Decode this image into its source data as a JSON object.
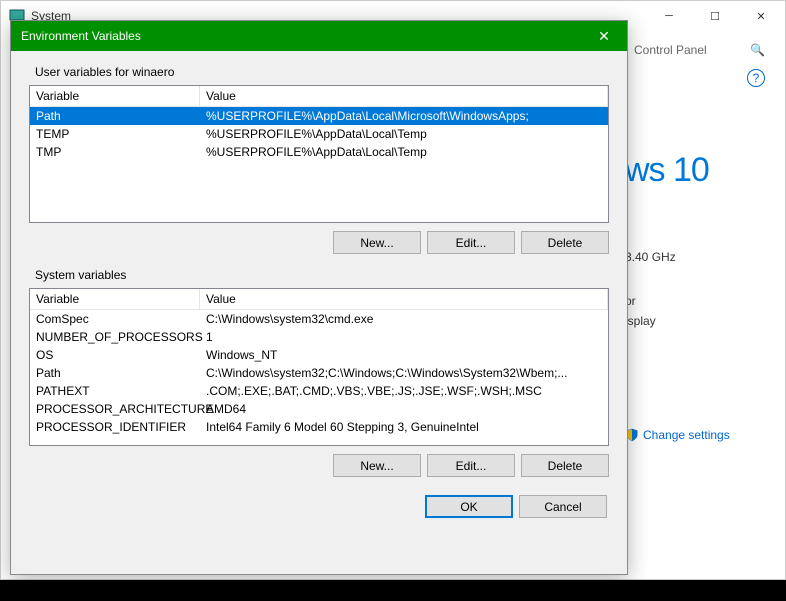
{
  "bg": {
    "title": "System",
    "control_panel": "Control Panel",
    "windows10": "ws 10",
    "ghz": "3.40 GHz",
    "or": "or",
    "isplay": "isplay",
    "change_settings": "Change settings",
    "search_placeholder": ""
  },
  "dialog": {
    "title": "Environment Variables",
    "user_section_label": "User variables for winaero",
    "sys_section_label": "System variables",
    "col_variable": "Variable",
    "col_value": "Value",
    "btn_new": "New...",
    "btn_edit": "Edit...",
    "btn_delete": "Delete",
    "btn_ok": "OK",
    "btn_cancel": "Cancel"
  },
  "user_vars": [
    {
      "name": "Path",
      "value": "%USERPROFILE%\\AppData\\Local\\Microsoft\\WindowsApps;",
      "selected": true
    },
    {
      "name": "TEMP",
      "value": "%USERPROFILE%\\AppData\\Local\\Temp",
      "selected": false
    },
    {
      "name": "TMP",
      "value": "%USERPROFILE%\\AppData\\Local\\Temp",
      "selected": false
    }
  ],
  "sys_vars": [
    {
      "name": "ComSpec",
      "value": "C:\\Windows\\system32\\cmd.exe"
    },
    {
      "name": "NUMBER_OF_PROCESSORS",
      "value": "1"
    },
    {
      "name": "OS",
      "value": "Windows_NT"
    },
    {
      "name": "Path",
      "value": "C:\\Windows\\system32;C:\\Windows;C:\\Windows\\System32\\Wbem;..."
    },
    {
      "name": "PATHEXT",
      "value": ".COM;.EXE;.BAT;.CMD;.VBS;.VBE;.JS;.JSE;.WSF;.WSH;.MSC"
    },
    {
      "name": "PROCESSOR_ARCHITECTURE",
      "value": "AMD64"
    },
    {
      "name": "PROCESSOR_IDENTIFIER",
      "value": "Intel64 Family 6 Model 60 Stepping 3, GenuineIntel"
    }
  ]
}
